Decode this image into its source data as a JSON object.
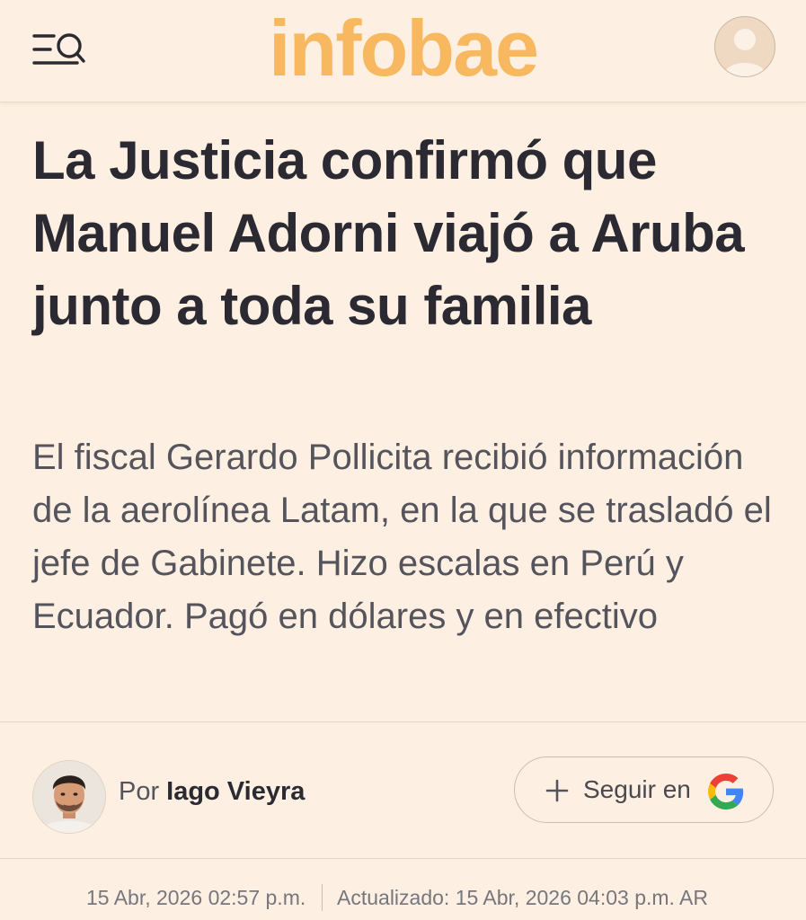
{
  "header": {
    "logo_text": "infobae",
    "menu_icon": "menu-search-icon",
    "user_icon": "user-icon",
    "logo_color": "#f8b860"
  },
  "article": {
    "headline": "La Justicia confirmó que Manuel Adorni viajó a Aruba junto a toda su familia",
    "subheadline": "El fiscal Gerardo Pollicita recibió información de la aerolínea Latam, en la que se trasladó el jefe de Gabinete. Hizo escalas en Perú y Ecuador. Pagó en dólares y en efectivo"
  },
  "byline": {
    "prefix": "Por",
    "author": "Iago Vieyra",
    "follow_label": "Seguir en",
    "follow_icon": "plus-icon",
    "google_icon": "google-g-icon"
  },
  "dates": {
    "published": "15 Abr, 2026 02:57 p.m.",
    "updated": "Actualizado: 15 Abr, 2026 04:03 p.m. AR"
  },
  "colors": {
    "background": "#fdf0e2",
    "text": "#2b2a33",
    "muted": "#55545c"
  }
}
